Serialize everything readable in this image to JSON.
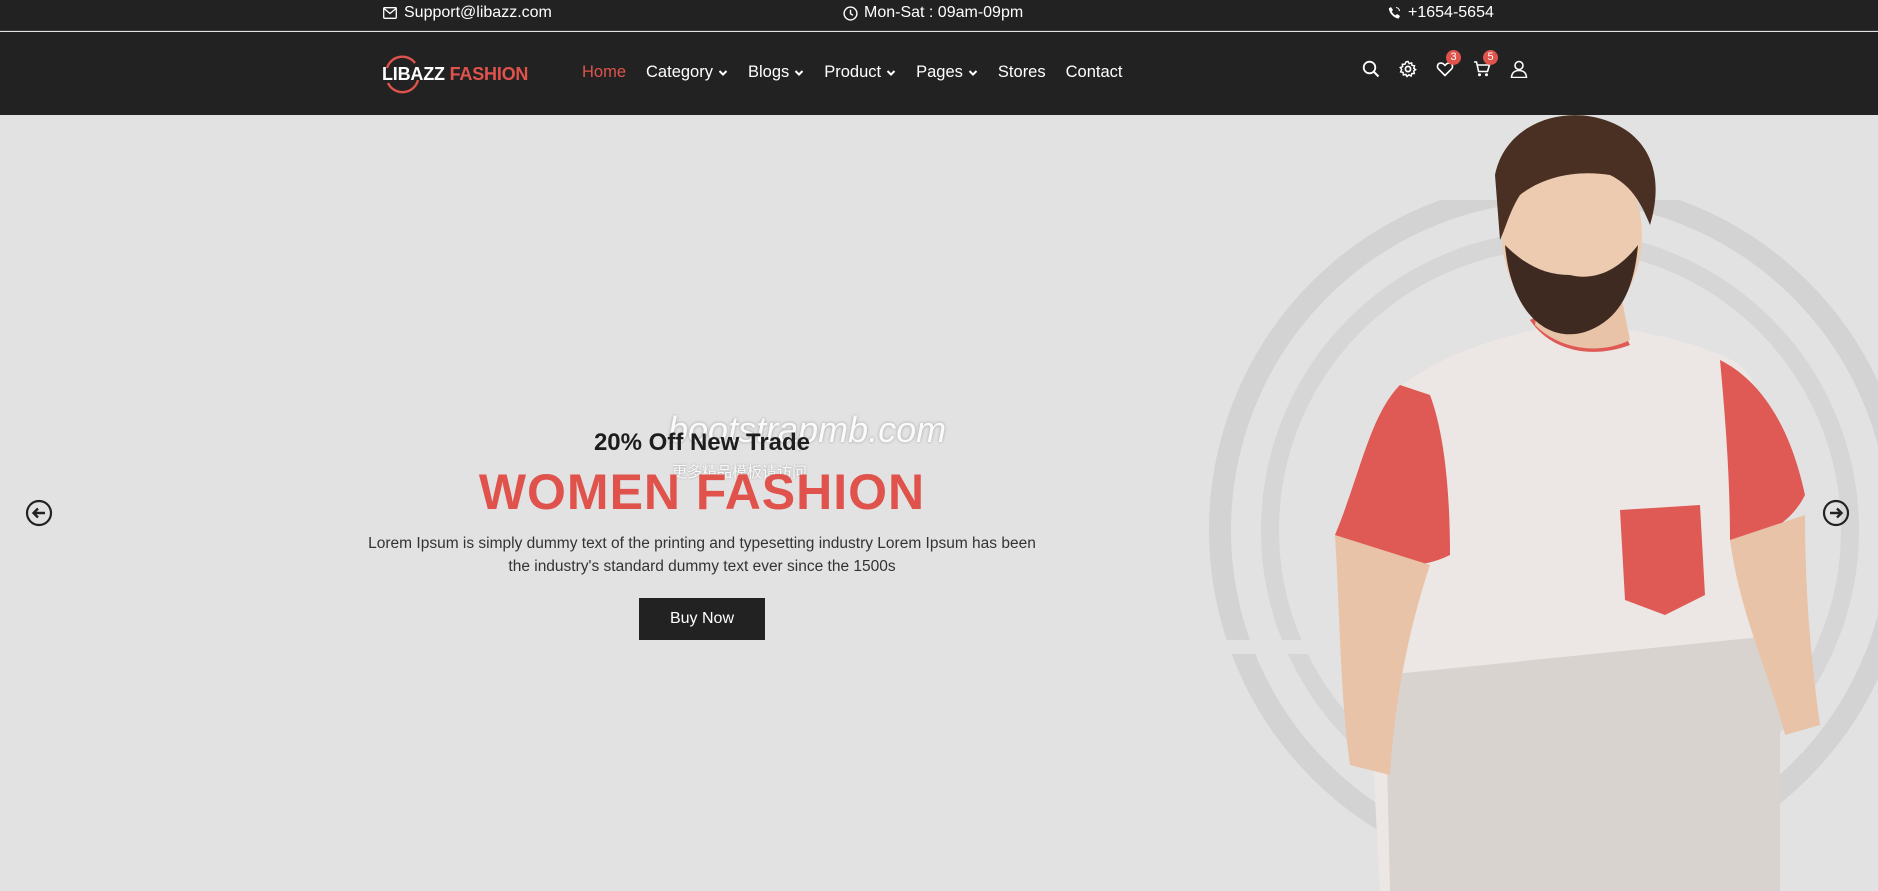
{
  "topbar": {
    "email": "Support@libazz.com",
    "hours": "Mon-Sat : 09am-09pm",
    "phone": "+1654-5654",
    "icons": {
      "email": "envelope-icon",
      "hours": "clock-icon",
      "phone": "phone-icon"
    }
  },
  "header": {
    "logo_part1": "LIBAZZ",
    "logo_part2": "FASHION",
    "nav": [
      {
        "label": "Home",
        "active": true
      },
      {
        "label": "Category",
        "dropdown": true
      },
      {
        "label": "Blogs",
        "dropdown": true
      },
      {
        "label": "Product",
        "dropdown": true
      },
      {
        "label": "Pages",
        "dropdown": true
      },
      {
        "label": "Stores"
      },
      {
        "label": "Contact"
      }
    ],
    "icons": {
      "search": "search-icon",
      "settings": "gear-icon",
      "wishlist": "heart-icon",
      "cart": "cart-icon",
      "account": "user-icon"
    },
    "wishlist_count": "3",
    "cart_count": "5"
  },
  "hero": {
    "subtitle": "20% Off New Trade",
    "title": "WOMEN FASHION",
    "description": "Lorem Ipsum is simply dummy text of the printing and typesetting industry Lorem Ipsum has been the industry's standard dummy text ever since the 1500s",
    "button": "Buy Now",
    "watermark": "bootstrapmb.com",
    "watermark_sub": "更多精品模板请访问",
    "prev_icon": "arrow-left-circle-icon",
    "next_icon": "arrow-right-circle-icon"
  },
  "colors": {
    "dark": "#222222",
    "accent": "#e0534c",
    "hero_bg": "#e2e2e2"
  }
}
